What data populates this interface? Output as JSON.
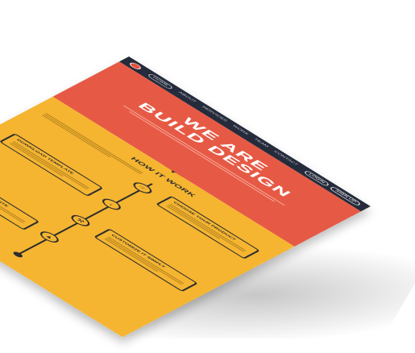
{
  "nav": {
    "items": [
      "HOME",
      "ABOUT",
      "SERVICES",
      "WORK",
      "TEAM",
      "CONTACT"
    ],
    "buttons": [
      "LOGIN",
      "SIGN UP"
    ]
  },
  "hero": {
    "title_line1": "WE ARE",
    "title_line2": "BUILD DESIGN"
  },
  "work": {
    "title": "HOW IT WORK",
    "steps": [
      {
        "title": "CHOOSE YOUR PRODUCT",
        "icon": "hand-icon"
      },
      {
        "title": "DOWNLOAD TEMPLATE",
        "icon": "download-icon"
      },
      {
        "title": "CUSTOMIZE IT SIMPLY",
        "icon": "wrench-icon"
      },
      {
        "title": "START YOUR WEBSITE",
        "icon": "thumbs-up-icon"
      }
    ]
  },
  "colors": {
    "header": "#252b3b",
    "hero": "#e65a45",
    "work": "#f5b531"
  }
}
